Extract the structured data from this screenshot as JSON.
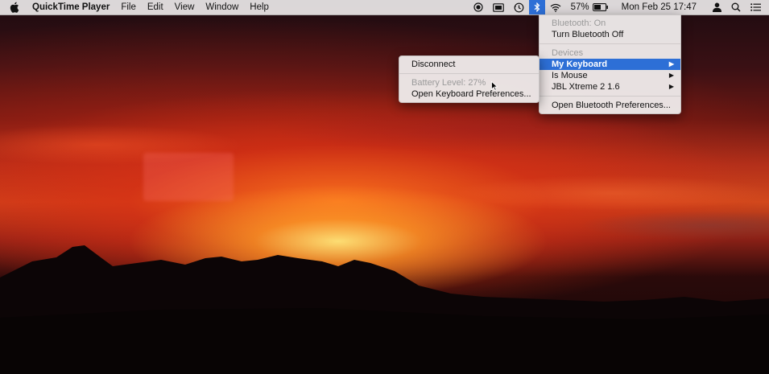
{
  "menubar": {
    "app_name": "QuickTime Player",
    "menus": [
      "File",
      "Edit",
      "View",
      "Window",
      "Help"
    ],
    "battery_percent": "57%",
    "clock": "Mon Feb 25  17:47"
  },
  "bluetooth_menu": {
    "status": "Bluetooth: On",
    "toggle": "Turn Bluetooth Off",
    "devices_header": "Devices",
    "devices": [
      "My Keyboard",
      "Is Mouse",
      "JBL Xtreme 2 1.6"
    ],
    "open_prefs": "Open Bluetooth Preferences..."
  },
  "device_submenu": {
    "disconnect": "Disconnect",
    "battery_level": "Battery Level: 27%",
    "open_prefs": "Open Keyboard Preferences..."
  },
  "colors": {
    "selection": "#2d6fd6",
    "menubar_bg": "#e8e4e4"
  }
}
